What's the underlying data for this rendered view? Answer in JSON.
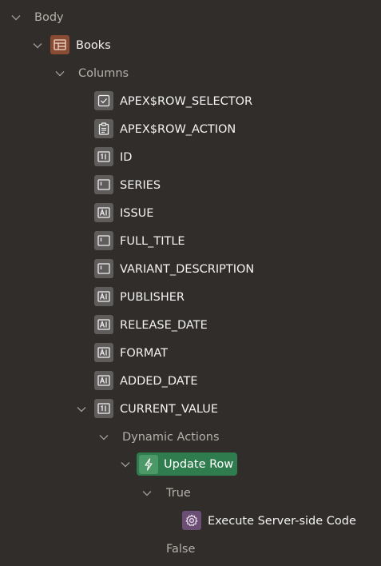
{
  "tree": {
    "body": {
      "label": "Body",
      "icon": "chevron-down-icon"
    },
    "region": {
      "label": "Books",
      "icon": "region-grid-icon",
      "color": "#8a4b33"
    },
    "columns_folder": {
      "label": "Columns"
    },
    "columns": [
      {
        "label": "APEX$ROW_SELECTOR",
        "icon": "checkbox-icon"
      },
      {
        "label": "APEX$ROW_ACTION",
        "icon": "clipboard-icon"
      },
      {
        "label": "ID",
        "icon": "number-field-icon"
      },
      {
        "label": "SERIES",
        "icon": "display-only-icon"
      },
      {
        "label": "ISSUE",
        "icon": "text-field-icon"
      },
      {
        "label": "FULL_TITLE",
        "icon": "display-only-icon"
      },
      {
        "label": "VARIANT_DESCRIPTION",
        "icon": "display-only-icon"
      },
      {
        "label": "PUBLISHER",
        "icon": "text-field-icon"
      },
      {
        "label": "RELEASE_DATE",
        "icon": "text-field-icon"
      },
      {
        "label": "FORMAT",
        "icon": "text-field-icon"
      },
      {
        "label": "ADDED_DATE",
        "icon": "text-field-icon"
      },
      {
        "label": "CURRENT_VALUE",
        "icon": "number-field-icon"
      }
    ],
    "dynamic_actions_folder": {
      "label": "Dynamic Actions"
    },
    "dynamic_action": {
      "label": "Update Row",
      "icon": "lightning-icon",
      "color": "#2f7d4f"
    },
    "true_branch": {
      "label": "True"
    },
    "true_action": {
      "label": "Execute Server-side Code",
      "icon": "gear-icon",
      "color": "#6a4e74"
    },
    "false_branch": {
      "label": "False"
    }
  }
}
